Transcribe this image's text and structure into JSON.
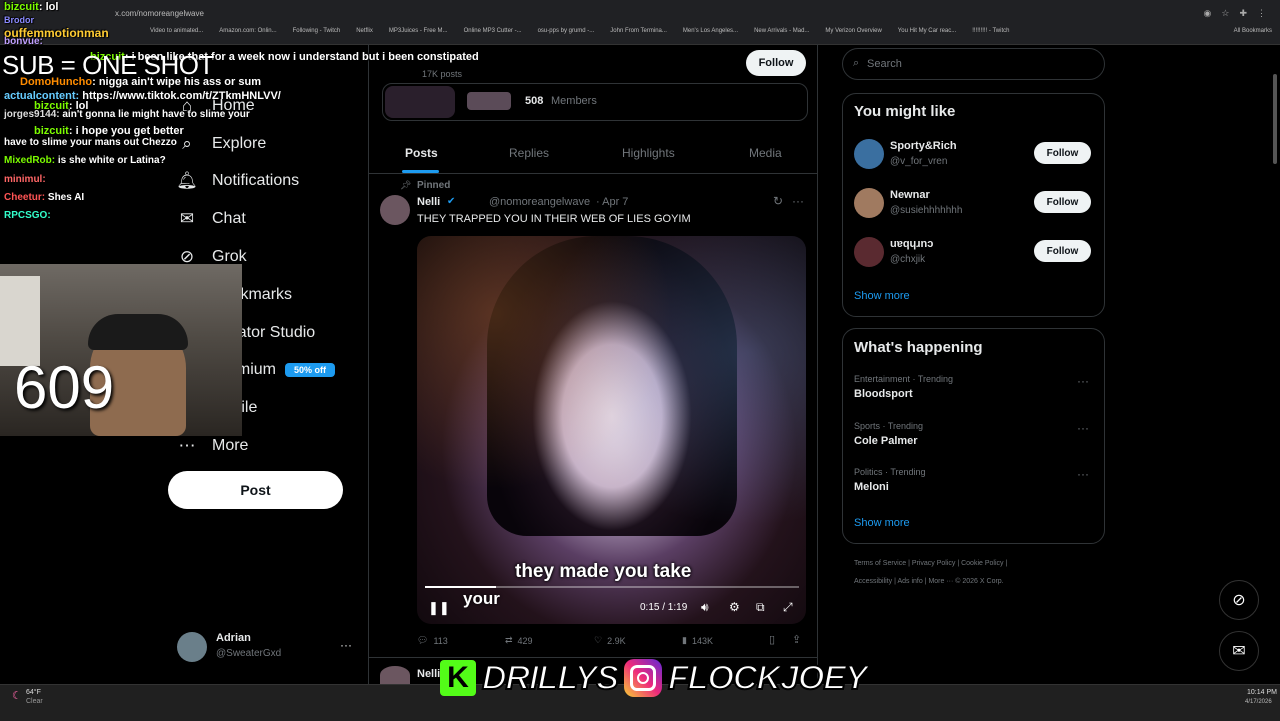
{
  "browser": {
    "url": "x.com/nomoreangelwave",
    "bookmarks": [
      "Video to animated...",
      "Amazon.com: Onlin...",
      "Following - Twitch",
      "Netflix",
      "MP3Juices - Free M...",
      "Online MP3 Cutter -...",
      "osu-pps by grumd -...",
      "John From Termina...",
      "Men's Los Angeles...",
      "New Arrivals - Mad...",
      "My Verizon Overview",
      "You Hit My Car reac...",
      "!!!!!!!!! - Twitch"
    ],
    "all_bookmarks": "All Bookmarks"
  },
  "chat": [
    {
      "user": "bizcuit",
      "text": ": lol",
      "color": "#7CFC00"
    },
    {
      "user": "Brodor",
      "text": "",
      "color": "#8a8aff"
    },
    {
      "user": "ouffemmotionman",
      "text": "",
      "color": "#ffcc33"
    },
    {
      "user": "bonvue:",
      "text": "",
      "color": "#c0a0ff"
    },
    {
      "user": "bizcuit",
      "text": ": i been like that for a week now i understand but i been constipated",
      "color": "#7CFC00"
    },
    {
      "user": "DomoHuncho",
      "text": ": nigga ain't wipe his ass or sum",
      "color": "#ff8c00"
    },
    {
      "user": "actualcontent:",
      "text": " https://www.tiktok.com/t/ZTkmHNLVV/",
      "color": "#66ccff"
    },
    {
      "user": "bizcuit",
      "text": ": lol",
      "color": "#7CFC00"
    },
    {
      "user": "jorges9144:",
      "text": " ain't gonna lie might have to slime your",
      "color": "#dddddd"
    },
    {
      "user": "bizcuit",
      "text": ": i hope you get better",
      "color": "#7CFC00"
    },
    {
      "user": "",
      "text": "have to slime your mans out Chezzo",
      "color": "#ffffff"
    },
    {
      "user": "MixedRob:",
      "text": " is she white or Latina?",
      "color": "#7CFC00"
    },
    {
      "user": "minimul:",
      "text": "",
      "color": "#ff6666"
    },
    {
      "user": "Cheetur:",
      "text": " Shes AI",
      "color": "#ff5555"
    },
    {
      "user": "RPCSGO:",
      "text": "",
      "color": "#33ffcc"
    }
  ],
  "overlay": {
    "sub_text": "SUB = ONE SHOT",
    "counter": "609",
    "kick_letter": "K",
    "handle1": "DRILLYS",
    "handle2": "FLOCKJOEY"
  },
  "nav": {
    "home": "Home",
    "explore": "Explore",
    "notifications": "Notifications",
    "chat": "Chat",
    "grok": "Grok",
    "bookmarks": "Bookmarks",
    "creator_studio": "Creator Studio",
    "premium": "Premium",
    "premium_badge": "50% off",
    "profile": "Profile",
    "more": "More",
    "post": "Post",
    "account_name": "Adrian",
    "account_handle": "@SweaterGxd"
  },
  "profile": {
    "posts_count": "17K posts",
    "follow": "Follow",
    "members_count": "508",
    "members_label": "Members",
    "tabs": [
      "Posts",
      "Replies",
      "Highlights",
      "Media"
    ]
  },
  "tweet": {
    "pinned": "Pinned",
    "name": "Nelli",
    "handle": "@nomoreangelwave",
    "date": "· Apr 7",
    "text": "THEY TRAPPED YOU IN THEIR WEB OF LIES GOYIM",
    "caption": "they made you take",
    "caption2": "your",
    "time": "0:15 / 1:19",
    "progress": 0.19,
    "replies": "113",
    "reposts": "429",
    "likes": "2.9K",
    "views": "143K",
    "next_name": "Nelli"
  },
  "right": {
    "search_placeholder": "Search",
    "you_might_like": "You might like",
    "suggestions": [
      {
        "name": "Sporty&Rich",
        "handle": "@v_for_vren",
        "follow": "Follow"
      },
      {
        "name": "Newnar",
        "handle": "@susiehhhhhhh",
        "follow": "Follow"
      },
      {
        "name": "uɐqɥɹnɔ",
        "handle": "@chxjik",
        "follow": "Follow"
      }
    ],
    "show_more": "Show more",
    "whats_happening": "What's happening",
    "trends": [
      {
        "category": "Entertainment · Trending",
        "name": "Bloodsport"
      },
      {
        "category": "Sports · Trending",
        "name": "Cole Palmer"
      },
      {
        "category": "Politics · Trending",
        "name": "Meloni"
      }
    ],
    "footer1": "Terms of Service  |  Privacy Policy  |  Cookie Policy  |",
    "footer2": "Accessibility  |  Ads info  |  More ···  © 2026 X Corp."
  },
  "taskbar": {
    "weather": "64°F",
    "weather_sub": "Clear",
    "time": "10:14 PM",
    "date": "4/17/2026"
  }
}
